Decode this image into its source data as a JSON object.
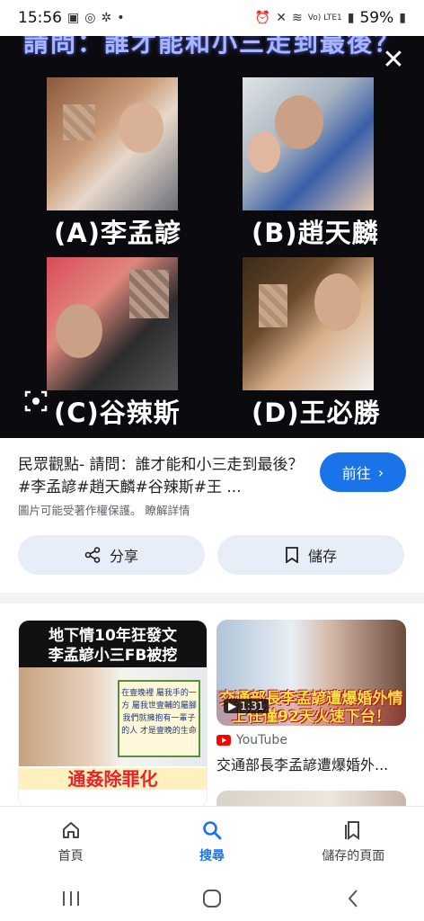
{
  "status_bar": {
    "time": "15:56",
    "battery": "59%",
    "network": "Vo) LTE1"
  },
  "hero": {
    "title": "請問：誰才能和小三走到最後？",
    "captions": [
      "(A)李孟諺",
      "(B)趙天麟",
      "(C)谷辣斯",
      "(D)王必勝"
    ]
  },
  "result": {
    "title": "民眾觀點- 請問：誰才能和小三走到最後？ #李孟諺#趙天麟#谷辣斯#王 ...",
    "goto_label": "前往",
    "copyright_note": "圖片可能受著作權保護。",
    "learn_more": "瞭解詳情",
    "share_label": "分享",
    "save_label": "儲存"
  },
  "related": {
    "left": {
      "headline_1": "地下情10年狂發文",
      "headline_2": "李孟諺小三FB被挖",
      "note": "在壹晚裡 屬我手的一方 屬我世壹輔的屬腳 我們就擁抱有一輩子的人 才是壹晚的生命",
      "footer": "通姦除罪化"
    },
    "right": {
      "overlay_text": "交通部長李孟諺遭爆婚外情 上任僅92天火速下台！",
      "duration": "1:31",
      "source": "YouTube",
      "title": "交通部長李孟諺遭爆婚外..."
    }
  },
  "bottom_nav": [
    {
      "label": "首頁",
      "icon": "home-icon"
    },
    {
      "label": "搜尋",
      "icon": "search-icon"
    },
    {
      "label": "儲存的頁面",
      "icon": "saved-pages-icon"
    }
  ],
  "colors": {
    "accent": "#1a73e8",
    "pill_bg": "#e8eef8",
    "hero_bg": "#0b0b0f"
  }
}
